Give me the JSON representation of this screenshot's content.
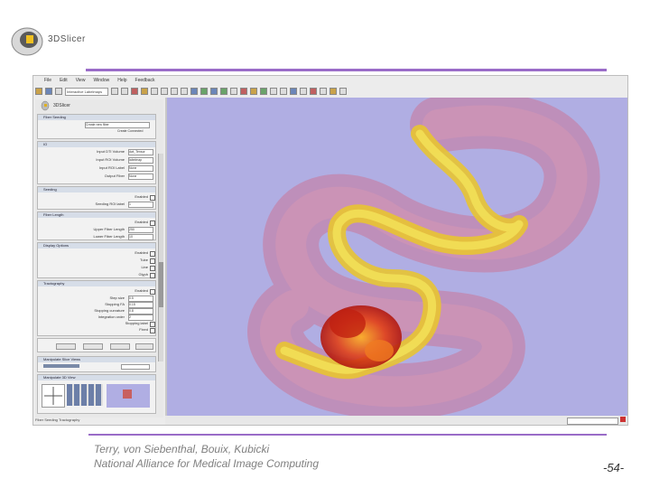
{
  "logo": {
    "text": "3DSlicer"
  },
  "app": {
    "menus": [
      "File",
      "Edit",
      "View",
      "Window",
      "Help",
      "Feedback"
    ],
    "toolbar_select": "Interactive Labelmaps",
    "module_title": "3DSlicer",
    "sections": [
      {
        "title": "Fiber Seeding",
        "rows": [
          {
            "label": "Fiber bundle",
            "value": "Create new fiber"
          },
          {
            "label": "",
            "value": "Create Connected"
          }
        ]
      },
      {
        "title": "IO",
        "rows": [
          {
            "label": "Input DTI Volume",
            "value": "dwi_Tensor"
          },
          {
            "label": "Input ROI Volume",
            "value": "labelmap"
          },
          {
            "label": "Input ROI Label",
            "value": "None"
          },
          {
            "label": "Output Fiber",
            "value": "None"
          }
        ]
      },
      {
        "title": "Seeding",
        "rows": [
          {
            "label": "Enabled",
            "value": ""
          },
          {
            "label": "Seeding ROI label",
            "value": "1"
          }
        ]
      },
      {
        "title": "Fiber Length",
        "rows": [
          {
            "label": "Enabled",
            "value": ""
          },
          {
            "label": "Upper Fiber Length",
            "value": "250"
          },
          {
            "label": "Lower Fiber Length",
            "value": "10"
          }
        ]
      },
      {
        "title": "Display Options",
        "rows": [
          {
            "label": "Enabled",
            "value": ""
          },
          {
            "label": "Tube",
            "value": ""
          },
          {
            "label": "Line",
            "value": ""
          },
          {
            "label": "Glyph",
            "value": ""
          }
        ]
      },
      {
        "title": "Tractography",
        "rows": [
          {
            "label": "Enabled",
            "value": ""
          },
          {
            "label": "Step size",
            "value": "0.5"
          },
          {
            "label": "Stopping FA",
            "value": "0.15"
          },
          {
            "label": "Stopping curvature",
            "value": "0.8"
          },
          {
            "label": "Integration order",
            "value": "2"
          },
          {
            "label": "Stopping label",
            "value": ""
          },
          {
            "label": "Fixed",
            "value": ""
          }
        ]
      }
    ],
    "lower_sections": [
      "Manipulate Slice Views",
      "Manipulate 3D View"
    ],
    "status": "Fiber Seeding Tractography"
  },
  "footer": {
    "authors": "Terry, von Siebenthal, Bouix, Kubicki",
    "org": "National Alliance for Medical Image Computing",
    "page": "-54-"
  },
  "colors": {
    "accent_line": "#9a6cc8",
    "viewer_bg": "#b0aee3",
    "footer_text": "#808080"
  }
}
